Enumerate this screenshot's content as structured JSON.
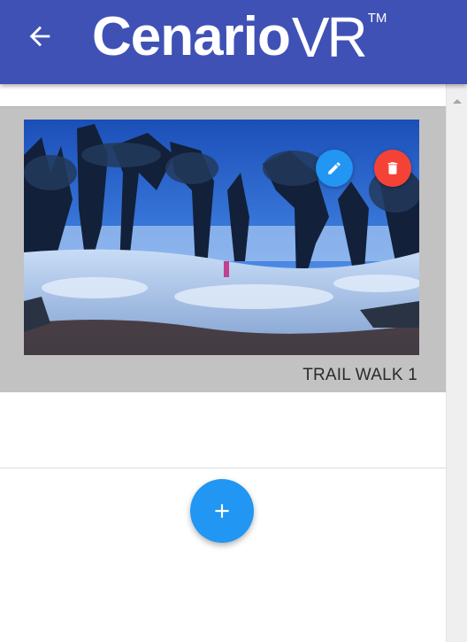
{
  "header": {
    "logo_main": "Cenario",
    "logo_vr": "VR",
    "logo_tm": "TM",
    "back_icon": "arrow-left-icon",
    "background_color": "#3f51b5"
  },
  "scenes": [
    {
      "title": "TRAIL WALK 1",
      "thumbnail": "snowy forest 360 panorama",
      "edit_icon": "pencil-icon",
      "delete_icon": "trash-icon"
    }
  ],
  "actions": {
    "add_icon": "plus-icon"
  },
  "colors": {
    "accent": "#2196f3",
    "danger": "#f44336",
    "card_background": "#c2c2c2"
  }
}
